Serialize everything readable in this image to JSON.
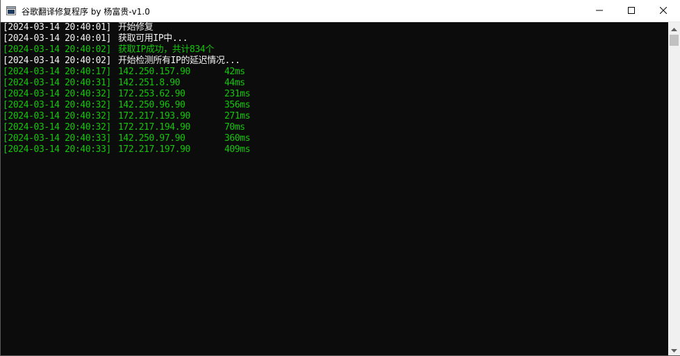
{
  "window": {
    "title": "谷歌翻译修复程序 by 杨富贵-v1.0"
  },
  "colors": {
    "console_bg": "#0c0c0c",
    "text_white": "#f2f2f2",
    "text_green": "#16c60c"
  },
  "console": {
    "lines": [
      {
        "ts": "[2024-03-14 20:40:01]",
        "text": "开始修复"
      },
      {
        "ts": "[2024-03-14 20:40:01]",
        "text": "获取可用IP中..."
      },
      {
        "ts": "[2024-03-14 20:40:02]",
        "text": "获取IP成功，共计834个"
      },
      {
        "ts": "[2024-03-14 20:40:02]",
        "text": "开始检测所有IP的延迟情况..."
      }
    ],
    "results": [
      {
        "ts": "[2024-03-14 20:40:17]",
        "ip": "142.250.157.90",
        "ms": "42ms"
      },
      {
        "ts": "[2024-03-14 20:40:31]",
        "ip": "142.251.8.90",
        "ms": "44ms"
      },
      {
        "ts": "[2024-03-14 20:40:32]",
        "ip": "172.253.62.90",
        "ms": "231ms"
      },
      {
        "ts": "[2024-03-14 20:40:32]",
        "ip": "142.250.96.90",
        "ms": "356ms"
      },
      {
        "ts": "[2024-03-14 20:40:32]",
        "ip": "172.217.193.90",
        "ms": "271ms"
      },
      {
        "ts": "[2024-03-14 20:40:32]",
        "ip": "172.217.194.90",
        "ms": "70ms"
      },
      {
        "ts": "[2024-03-14 20:40:33]",
        "ip": "142.250.97.90",
        "ms": "360ms"
      },
      {
        "ts": "[2024-03-14 20:40:33]",
        "ip": "172.217.197.90",
        "ms": "409ms"
      }
    ]
  },
  "icons": {
    "app": "console-app-icon",
    "minimize": "minimize-icon",
    "maximize": "maximize-icon",
    "close": "close-icon",
    "scroll_up": "scroll-up-arrow-icon",
    "scroll_down": "scroll-down-arrow-icon"
  }
}
